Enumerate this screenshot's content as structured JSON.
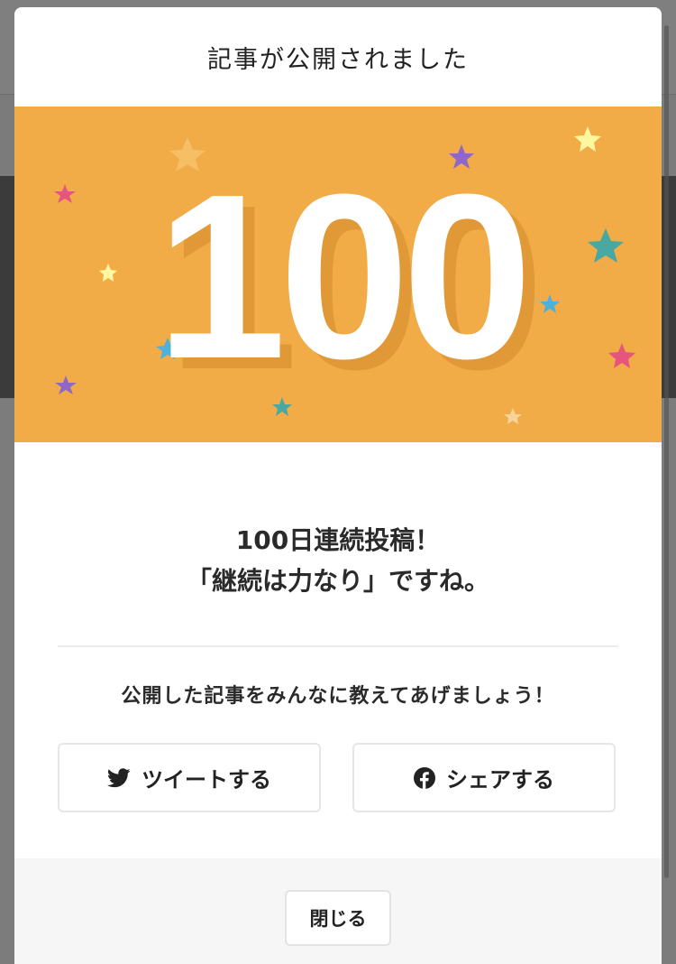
{
  "modal": {
    "title": "記事が公開されました",
    "banner_number": "100",
    "colors": {
      "banner": "#f1ac48",
      "text": "#2a2a2a"
    }
  },
  "message": {
    "line1": "100日連続投稿！",
    "line2": "「継続は力なり」ですね。"
  },
  "share": {
    "prompt": "公開した記事をみんなに教えてあげましょう！",
    "tweet_label": "ツイートする",
    "tweet_icon": "twitter-bird-icon",
    "facebook_label": "シェアする",
    "facebook_icon": "facebook-icon"
  },
  "footer": {
    "close_label": "閉じる"
  }
}
